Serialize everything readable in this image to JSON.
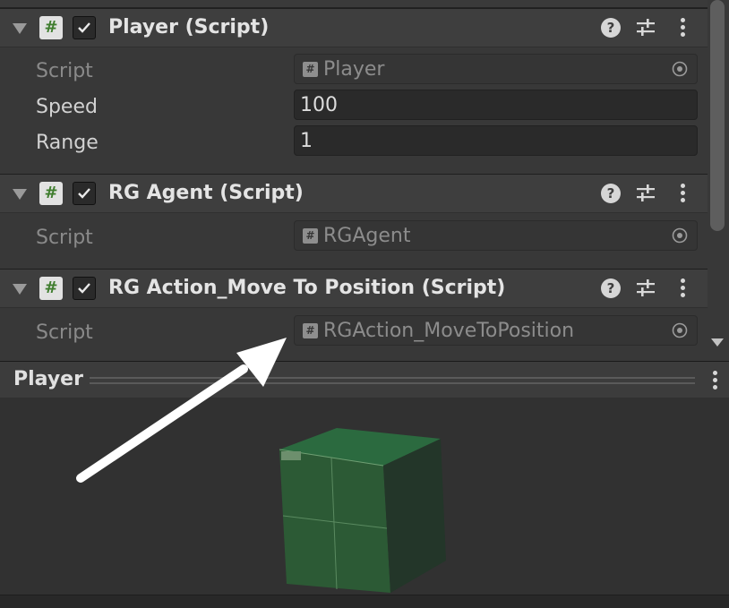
{
  "components": [
    {
      "title": "Player (Script)",
      "enabled": true,
      "fields": [
        {
          "label": "Script",
          "value": "Player",
          "kind": "object"
        },
        {
          "label": "Speed",
          "value": "100",
          "kind": "number"
        },
        {
          "label": "Range",
          "value": "1",
          "kind": "number"
        }
      ]
    },
    {
      "title": "RG Agent (Script)",
      "enabled": true,
      "fields": [
        {
          "label": "Script",
          "value": "RGAgent",
          "kind": "object"
        }
      ]
    },
    {
      "title": "RG Action_Move To Position (Script)",
      "enabled": true,
      "fields": [
        {
          "label": "Script",
          "value": "RGAction_MoveToPosition",
          "kind": "object"
        }
      ]
    }
  ],
  "preview": {
    "title": "Player"
  },
  "icons": {
    "script": "#",
    "help": "?",
    "colors": {
      "script_icon": "#3f7d2e",
      "cube": "#2f6a3f",
      "arrow": "#ffffff"
    }
  }
}
